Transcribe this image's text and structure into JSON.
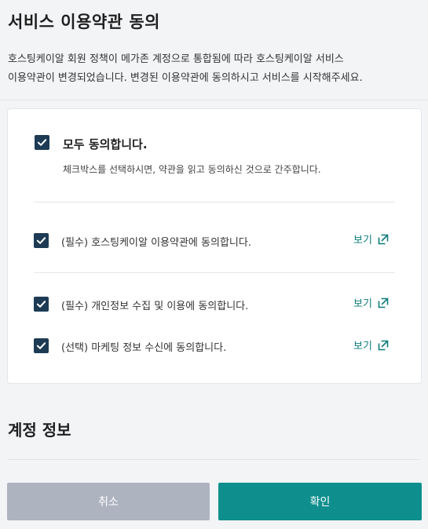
{
  "header": {
    "title": "서비스 이용약관 동의"
  },
  "intro": {
    "line1": "호스팅케이알 회원 정책이 메가존 계정으로 통합됨에 따라 호스팅케이알 서비스",
    "line2": "이용약관이 변경되었습니다. 변경된 이용약관에 동의하시고 서비스를 시작해주세요."
  },
  "agreement": {
    "all": {
      "label": "모두 동의합니다.",
      "description": "체크박스를 선택하시면, 약관을 읽고 동의하신 것으로 간주합니다.",
      "checked": true
    },
    "terms": [
      {
        "label": "(필수) 호스팅케이알 이용약관에 동의합니다.",
        "link": "보기",
        "checked": true
      },
      {
        "label": "(필수) 개인정보 수집 및 이용에 동의합니다.",
        "link": "보기",
        "checked": true
      },
      {
        "label": "(선택) 마케팅 정보 수신에 동의합니다.",
        "link": "보기",
        "checked": true
      }
    ],
    "checkbox_color": "#1d3b54",
    "link_color": "#0e7c7b"
  },
  "account": {
    "title": "계정 정보"
  },
  "actions": {
    "cancel_label": "취소",
    "confirm_label": "확인",
    "cancel_color": "#aeb3c0",
    "confirm_color": "#0e8f8e"
  },
  "icons": {
    "checkbox": "checkmark-icon",
    "external": "external-link-icon"
  }
}
